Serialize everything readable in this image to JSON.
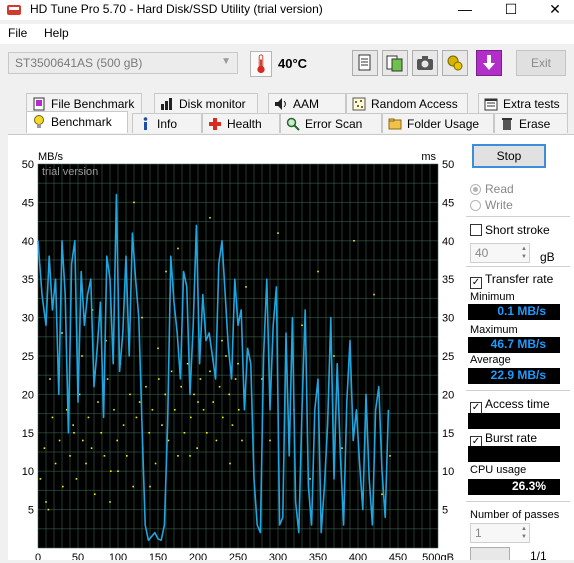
{
  "window": {
    "title": "HD Tune Pro 5.70 - Hard Disk/SSD Utility (trial version)",
    "minimize": "—",
    "maximize": "☐",
    "close": "✕"
  },
  "menu": {
    "file": "File",
    "help": "Help"
  },
  "toolbar": {
    "drive": "ST3500641AS (500 gB)",
    "temperature": "40°C",
    "exit": "Exit",
    "icons": [
      "copy-text-icon",
      "copy-screenshot-icon",
      "camera-icon",
      "options-icon",
      "save-down-icon"
    ]
  },
  "tabs": {
    "row1": [
      "File Benchmark",
      "Disk monitor",
      "AAM",
      "Random Access",
      "Extra tests"
    ],
    "row2": [
      "Benchmark",
      "Info",
      "Health",
      "Error Scan",
      "Folder Usage",
      "Erase"
    ],
    "active": "Benchmark"
  },
  "controls": {
    "stop": "Stop",
    "read": "Read",
    "write": "Write",
    "short_stroke": "Short stroke",
    "short_stroke_value": "40",
    "short_stroke_unit": "gB",
    "transfer_rate": "Transfer rate",
    "access_time": "Access time",
    "burst_rate": "Burst rate",
    "cpu_usage_label": "CPU usage",
    "passes_label": "Number of passes",
    "passes_value": "1",
    "page": "1/1"
  },
  "stats": {
    "minimum_label": "Minimum",
    "minimum": "0.1 MB/s",
    "maximum_label": "Maximum",
    "maximum": "46.7 MB/s",
    "average_label": "Average",
    "average": "22.9 MB/s",
    "cpu_usage": "26.3%"
  },
  "colors": {
    "plot_bg": "#000000",
    "grid": "#3e6b54",
    "transfer": "#1fa6e0",
    "access": "#f2f20d",
    "stat_text": "#1e9bff"
  },
  "chart_data": {
    "type": "line",
    "watermark": "trial version",
    "y_left_unit": "MB/s",
    "y_right_unit": "ms",
    "x_unit": "gB",
    "xlim": [
      0,
      500
    ],
    "ylim": [
      0,
      50
    ],
    "x_ticks": [
      0,
      50,
      100,
      150,
      200,
      250,
      300,
      350,
      400,
      450,
      500
    ],
    "y_ticks": [
      5,
      10,
      15,
      20,
      25,
      30,
      35,
      40,
      45,
      50
    ],
    "grid": true,
    "series": [
      {
        "x": [
          0,
          5,
          10,
          14,
          18,
          22,
          26,
          30,
          34,
          38,
          42,
          46,
          50,
          54,
          58,
          62,
          66,
          70,
          74,
          78,
          82,
          86,
          90,
          94,
          98,
          102,
          106,
          110,
          114,
          118,
          122,
          126,
          130,
          134,
          138,
          142,
          146,
          150,
          154,
          158,
          162,
          166,
          170,
          174,
          178,
          182,
          186,
          190,
          194,
          198,
          202,
          206,
          210,
          214,
          218,
          222,
          226,
          230,
          234,
          238,
          242,
          246,
          250,
          254,
          258,
          262,
          266,
          270,
          274,
          278,
          282,
          286,
          290,
          294,
          298,
          302,
          306,
          310,
          314,
          318,
          322,
          326,
          330,
          334,
          338,
          342,
          346,
          350,
          354,
          358,
          362,
          366,
          370,
          374,
          378,
          382,
          386,
          390,
          394,
          398,
          402,
          406,
          410,
          414,
          418,
          422,
          426,
          430,
          434,
          438
        ],
        "y": [
          40,
          33,
          29,
          38,
          31,
          35,
          20,
          40,
          33,
          15,
          37,
          40,
          19,
          36,
          29,
          33,
          35,
          21,
          26,
          32,
          17,
          38,
          35,
          24,
          46,
          23,
          28,
          38,
          25,
          41,
          35,
          30,
          16,
          3,
          1,
          1.5,
          2,
          1.2,
          1,
          3,
          16,
          38,
          32,
          28,
          22,
          36,
          34,
          20,
          29,
          42,
          24,
          33,
          27,
          28,
          25,
          22,
          37,
          40,
          33,
          26,
          22,
          35,
          29,
          31,
          18,
          26,
          24,
          9,
          3,
          2,
          25,
          35,
          18,
          29,
          34,
          3,
          4,
          28,
          12,
          30,
          6,
          2,
          18,
          31,
          8,
          3,
          18,
          22,
          2,
          8,
          16,
          30,
          9,
          24,
          12,
          3,
          19,
          27,
          14,
          18,
          11,
          5,
          20,
          9,
          3,
          18,
          21,
          10,
          4,
          18
        ]
      }
    ],
    "access_points": [
      [
        3,
        9
      ],
      [
        8,
        13
      ],
      [
        13,
        5
      ],
      [
        18,
        17
      ],
      [
        22,
        11
      ],
      [
        27,
        14
      ],
      [
        31,
        8
      ],
      [
        36,
        18
      ],
      [
        40,
        12
      ],
      [
        44,
        16
      ],
      [
        48,
        9
      ],
      [
        52,
        20
      ],
      [
        56,
        14
      ],
      [
        60,
        11
      ],
      [
        63,
        17
      ],
      [
        67,
        13
      ],
      [
        71,
        7
      ],
      [
        75,
        19
      ],
      [
        79,
        15
      ],
      [
        83,
        12
      ],
      [
        87,
        22
      ],
      [
        91,
        10
      ],
      [
        95,
        18
      ],
      [
        99,
        14
      ],
      [
        103,
        24
      ],
      [
        107,
        16
      ],
      [
        111,
        12
      ],
      [
        115,
        20
      ],
      [
        119,
        8
      ],
      [
        123,
        17
      ],
      [
        127,
        19
      ],
      [
        131,
        13
      ],
      [
        135,
        21
      ],
      [
        139,
        15
      ],
      [
        143,
        18
      ],
      [
        147,
        11
      ],
      [
        151,
        22
      ],
      [
        155,
        16
      ],
      [
        159,
        20
      ],
      [
        163,
        14
      ],
      [
        167,
        23
      ],
      [
        171,
        18
      ],
      [
        175,
        12
      ],
      [
        179,
        21
      ],
      [
        183,
        15
      ],
      [
        187,
        24
      ],
      [
        191,
        17
      ],
      [
        195,
        20
      ],
      [
        199,
        13
      ],
      [
        203,
        22
      ],
      [
        207,
        18
      ],
      [
        211,
        15
      ],
      [
        215,
        23
      ],
      [
        219,
        19
      ],
      [
        223,
        14
      ],
      [
        227,
        21
      ],
      [
        231,
        17
      ],
      [
        235,
        25
      ],
      [
        239,
        20
      ],
      [
        243,
        16
      ],
      [
        247,
        22
      ],
      [
        251,
        18
      ],
      [
        255,
        14
      ],
      [
        30,
        28
      ],
      [
        55,
        25
      ],
      [
        85,
        27
      ],
      [
        120,
        45
      ],
      [
        160,
        36
      ],
      [
        175,
        39
      ],
      [
        215,
        43
      ],
      [
        260,
        34
      ],
      [
        300,
        41
      ],
      [
        330,
        29
      ],
      [
        350,
        36
      ],
      [
        395,
        40
      ],
      [
        420,
        33
      ],
      [
        10,
        6
      ],
      [
        100,
        10
      ],
      [
        200,
        19
      ],
      [
        250,
        24
      ],
      [
        150,
        26
      ],
      [
        68,
        31
      ],
      [
        130,
        30
      ],
      [
        230,
        27
      ],
      [
        280,
        22
      ],
      [
        320,
        18
      ],
      [
        370,
        25
      ],
      [
        410,
        17
      ],
      [
        440,
        12
      ],
      [
        15,
        22
      ],
      [
        45,
        15
      ],
      [
        90,
        6
      ],
      [
        140,
        8
      ],
      [
        190,
        12
      ],
      [
        240,
        11
      ],
      [
        290,
        14
      ],
      [
        340,
        9
      ],
      [
        380,
        13
      ],
      [
        430,
        7
      ]
    ]
  }
}
